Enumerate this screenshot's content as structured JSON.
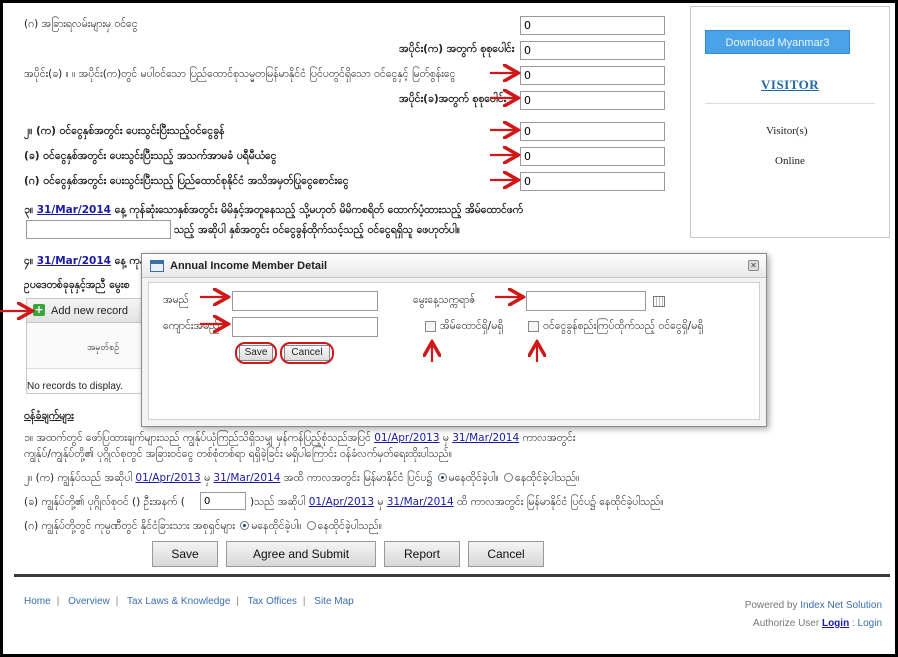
{
  "form": {
    "row_g_label": "(ဂ) အခြားရလမ်းများမှ ဝင်ငွေ",
    "row_g_value": "0",
    "total_a_label": "အပိုင်း(က) အတွက် စုစုပေါင်း",
    "total_a_value": "0",
    "part_b_label": "အပိုင်း(ခ) ။ ။ အပိုင်း(က)တွင် မပါဝင်သော ပြည်ထောင်စုသမ္မတမြန်မာနိုင်ငံ ပြင်ပတွင်ရှိသော ဝင်ငွေနှင့် မြတ်စွန်းငွေ",
    "part_b_value": "0",
    "total_b_label": "အပိုင်း(ခ)အတွက် စုစုပေါင်း",
    "total_b_value": "0",
    "q2a_label": "၂။ (က) ဝင်ငွေနှစ်အတွင်း ပေးသွင်းပြီးသည့်ဝင်ငွေခွန်",
    "q2a_value": "0",
    "q2b_label": "(ခ) ဝင်ငွေနှစ်အတွင်း ပေးသွင်းပြီးသည့် အသက်အာမခံ ပရီမီယံငွေ",
    "q2b_value": "0",
    "q2c_label": "(ဂ) ဝင်ငွေနှစ်အတွင်း ပေးသွင်းပြီးသည့် ပြည်ထောင်စုနိုင်ငံ အသိအမှတ်ပြုငွေစောင်းငွေ",
    "q2c_value": "0",
    "q3_prefix": "၃။",
    "q3_date": "31/Mar/2014",
    "q3_text": "နေ့ ကုန်ဆုံးသောနှစ်အတွင်း မိမိနှင့်အတူနေသည့် သို့မဟုတ် မိမိကစရိတ် ထောက်ပံ့ထားသည့် အိမ်ထောင်ဖက်",
    "q3_line2": "သည့် အဆိုပါ နှစ်အတွင်း ဝင်ငွေခွန်ထိုက်သင့်သည့် ဝင်ငွေရရှိသူ ဖေဟုတ်ပါ။",
    "q4_prefix": "၄။",
    "q4_date": "31/Mar/2014",
    "q4_text": "နေ့ ကုန်",
    "q4_line2": "ဥပဒေတစ်ခုခုနှင့်အညီ မွေးစ",
    "add_record": "Add new record",
    "grid_col": "အမှတ်စဉ်",
    "no_records": "No records to display.",
    "notes_title": "ဝန်ခံချက်များ",
    "note1a": "၁။ အထက်တွင် ဖော်ပြထားချက်များသည် ကျွန်ုပ်ယုံကြည်သိရှိသမျှ မှန်ကန်ပြည့်စုံသည်အပြင်",
    "note1_date1": "01/Apr/2013",
    "note1_mid": "မှ",
    "note1_date2": "31/Mar/2014",
    "note1_end": "ကာလအတွင်း",
    "note1b": "ကျွန်ုပ်/ကျွန်ုပ်တို့၏ ပုဂ္ဂိုလ်စုတွင် အခြားဝင်ငွေ တစ်စုံတစ်ရာ ရရှိခဲ့ခြင်း မရှိပါကြောင်း ဝန်ခံလက်မှတ်ရေးထိုးပါသည်။",
    "note2a_pre": "၂။ (က) ကျွန်ုပ်သည် အဆိုပါ",
    "note2a_date1": "01/Apr/2013",
    "note2a_mid": "မှ",
    "note2a_date2": "31/Mar/2014",
    "note2a_end": "အထိ ကာလအတွင်း မြန်မာနိုင်ငံ ပြင်ပ၌",
    "note2a_opt1": "မနေထိုင်ခဲ့ပါ။",
    "note2a_opt2": "နေထိုင်ခဲ့ပါသည်။",
    "note2b_pre": "(ခ) ကျွန်ုပ်တို့၏ ပုဂ္ဂိုလ်စုဝင် () ဦးအနက် (",
    "note2b_value": "0",
    "note2b_mid": ")သည် အဆိုပါ",
    "note2b_date1": "01/Apr/2013",
    "note2b_mid2": "မှ",
    "note2b_date2": "31/Mar/2014",
    "note2b_end": "ထိ ကာလအတွင်း မြန်မာနိုင်ငံ ပြင်ပ၌ နေထိုင်ခဲ့ပါသည်။",
    "note2c_pre": "(ဂ) ကျွန်ုပ်တို့တွင် ကုမ္ပဏီတွင် နိုင်ငံခြားသား အစုရှင်များ",
    "note2c_opt1": "မနေထိုင်ခဲ့ပါ။",
    "note2c_opt2": "နေထိုင်ခဲ့ပါသည်။"
  },
  "actions": {
    "save": "Save",
    "agree": "Agree and Submit",
    "report": "Report",
    "cancel": "Cancel"
  },
  "sidebar": {
    "download": "Download Myanmar3",
    "visitor_title": "VISITOR",
    "visitors": "Visitor(s)",
    "online": "Online"
  },
  "footer": {
    "links": [
      "Home",
      "Overview",
      "Tax Laws & Knowledge",
      "Tax Offices",
      "Site Map"
    ],
    "powered_pre": "Powered by",
    "powered_by": "Index Net Solution",
    "authorize": "Authorize User",
    "login_u": "Login",
    "login": "Login"
  },
  "dialog": {
    "title": "Annual Income Member Detail",
    "name_label": "အမည်",
    "name_value": "",
    "nrc_label": "ကျောင်းအမည်",
    "nrc_value": "",
    "dob_label": "မွေးနေ့သက္ကရာဇ်",
    "dob_value": "",
    "chk1_label": "အိမ်ထောင်ရှိ/မရှိ",
    "chk2_label": "ဝင်ငွေခွန်စည်းကြပ်ထိုက်သည့် ဝင်ငွေရှိ/မရှိ",
    "save": "Save",
    "cancel": "Cancel"
  },
  "colors": {
    "annotation": "#d01818",
    "link": "#1a1aa8",
    "download_button": "#4aa3e8",
    "visitor_title": "#1e6aa8"
  }
}
